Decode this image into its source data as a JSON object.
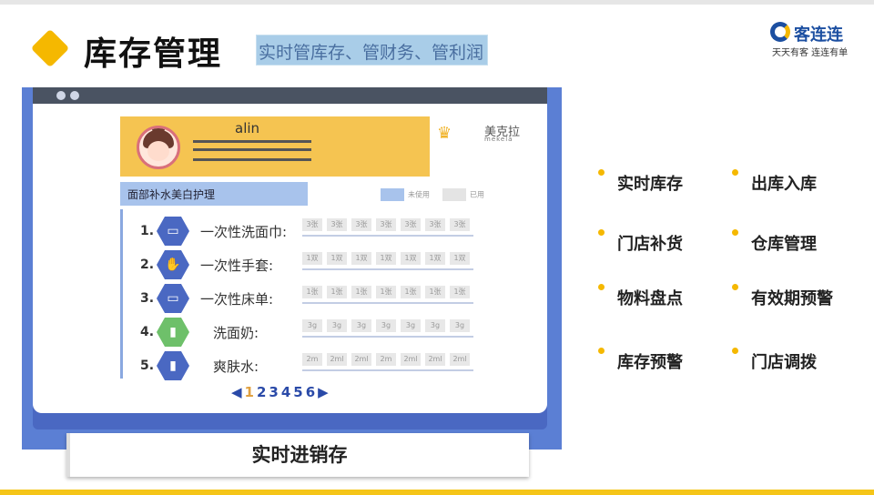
{
  "header": {
    "title": "库存管理",
    "subtitle": "实时管库存、管财务、管利润"
  },
  "logo": {
    "name": "客连连",
    "slogan": "天天有客 连连有单"
  },
  "illustration": {
    "username": "alin",
    "brand_name": "美克拉",
    "brand_sub": "mekela",
    "category": "面部补水美白护理",
    "legend_unused": "未使用",
    "legend_used": "已用",
    "items": [
      {
        "no": "1.",
        "name": "一次性洗面巾:",
        "cells": [
          "3张",
          "3张",
          "3张",
          "3张",
          "3张",
          "3张",
          "3张"
        ]
      },
      {
        "no": "2.",
        "name": "一次性手套:",
        "cells": [
          "1双",
          "1双",
          "1双",
          "1双",
          "1双",
          "1双",
          "1双"
        ]
      },
      {
        "no": "3.",
        "name": "一次性床单:",
        "cells": [
          "1张",
          "1张",
          "1张",
          "1张",
          "1张",
          "1张",
          "1张"
        ]
      },
      {
        "no": "4.",
        "name": "洗面奶:",
        "cells": [
          "3g",
          "3g",
          "3g",
          "3g",
          "3g",
          "3g",
          "3g"
        ]
      },
      {
        "no": "5.",
        "name": "爽肤水:",
        "cells": [
          "2m",
          "2ml",
          "2ml",
          "2m",
          "2ml",
          "2ml",
          "2ml"
        ]
      }
    ],
    "pages": [
      "1",
      "2",
      "3",
      "4",
      "5",
      "6"
    ],
    "caption": "实时进销存"
  },
  "features": [
    "实时库存",
    "出库入库",
    "门店补货",
    "仓库管理",
    "物料盘点",
    "有效期预警",
    "库存预警",
    "门店调拨"
  ],
  "colors": {
    "accent": "#f5b800",
    "window_blue": "#5b7fd4",
    "profile_yellow": "#f5c451",
    "logo_blue": "#1c4fa1"
  }
}
